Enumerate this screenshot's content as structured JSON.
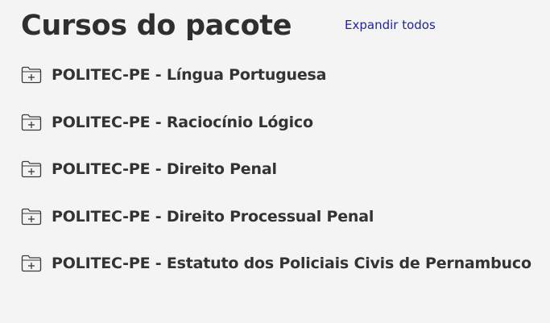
{
  "header": {
    "title": "Cursos do pacote",
    "expand_all_label": "Expandir todos"
  },
  "courses": [
    {
      "label": "POLITEC-PE - Língua Portuguesa",
      "icon": "folder-plus-icon"
    },
    {
      "label": "POLITEC-PE - Raciocínio Lógico",
      "icon": "folder-plus-icon"
    },
    {
      "label": "POLITEC-PE - Direito Penal",
      "icon": "folder-plus-icon"
    },
    {
      "label": "POLITEC-PE - Direito Processual Penal",
      "icon": "folder-plus-icon"
    },
    {
      "label": "POLITEC-PE - Estatuto dos Policiais Civis de Pernambuco",
      "icon": "folder-plus-icon"
    }
  ],
  "colors": {
    "background": "#f4f4f4",
    "text": "#333333",
    "link": "#23239b"
  }
}
